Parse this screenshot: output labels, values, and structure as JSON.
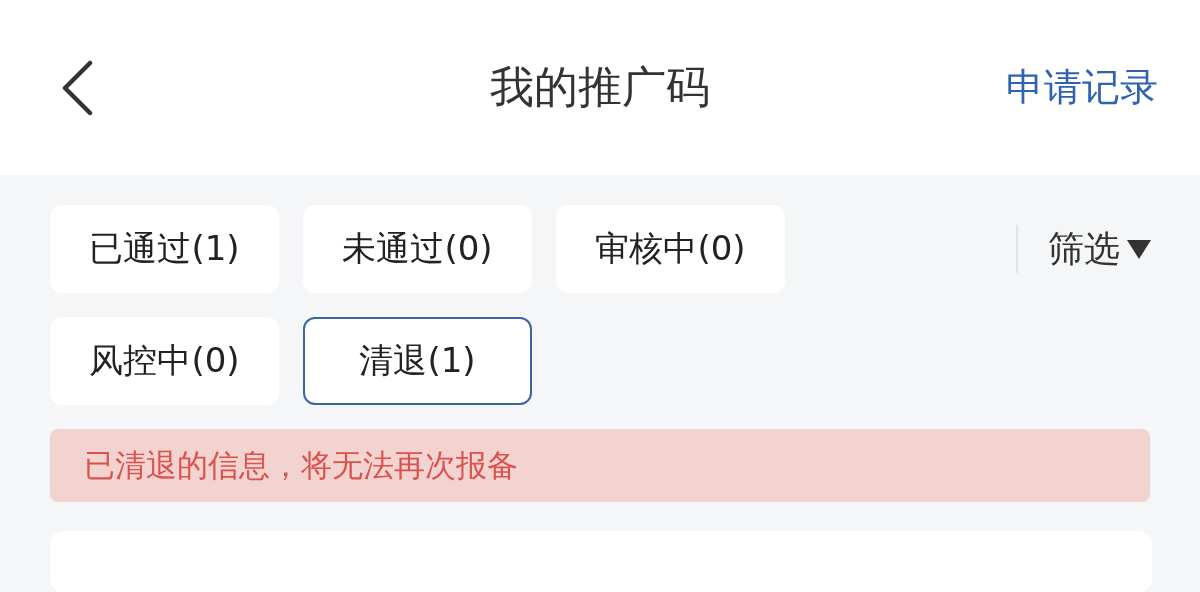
{
  "header": {
    "title": "我的推广码",
    "action": "申请记录"
  },
  "tabs": [
    {
      "label": "已通过(1)",
      "selected": false
    },
    {
      "label": "未通过(0)",
      "selected": false
    },
    {
      "label": "审核中(0)",
      "selected": false
    },
    {
      "label": "风控中(0)",
      "selected": false
    },
    {
      "label": "清退(1)",
      "selected": true
    }
  ],
  "filter": {
    "label": "筛选"
  },
  "notice": {
    "text": "已清退的信息，将无法再次报备"
  }
}
